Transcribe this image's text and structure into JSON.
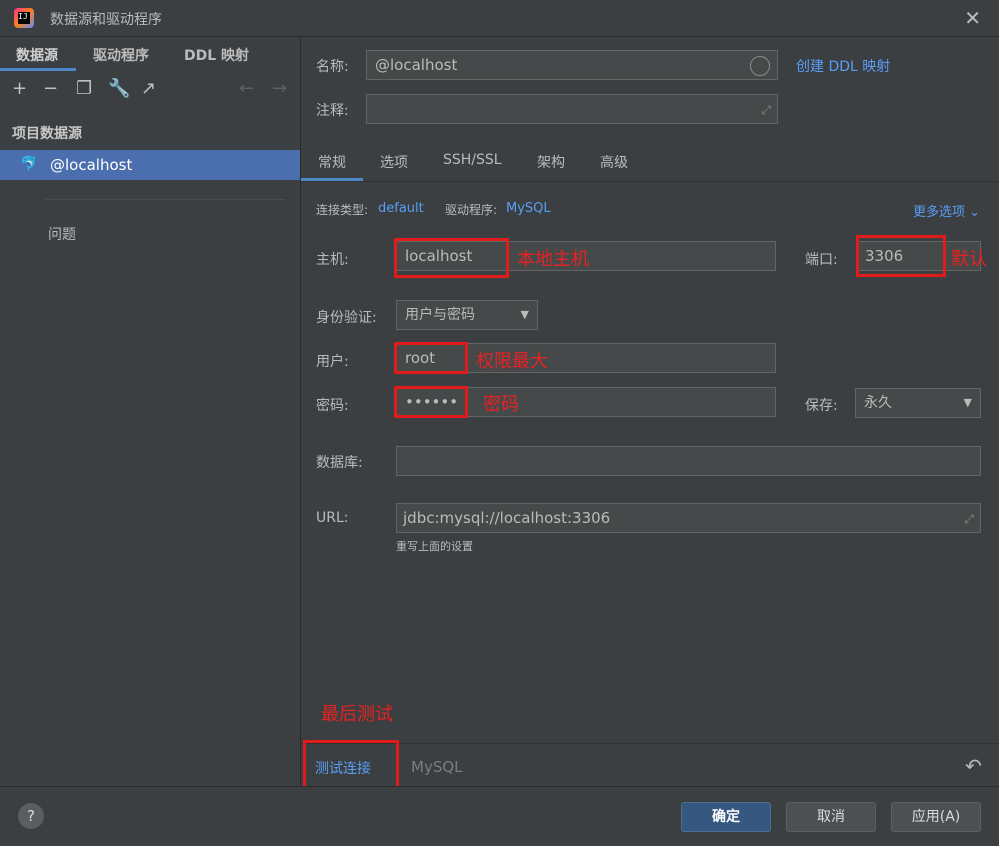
{
  "window": {
    "title": "数据源和驱动程序",
    "close_label": "✕"
  },
  "left": {
    "tabs": [
      "数据源",
      "驱动程序",
      "DDL 映射"
    ],
    "toolbar_icons": [
      "add-icon",
      "remove-icon",
      "copy-icon",
      "wrench-icon",
      "jump-icon",
      "back-arrow-icon",
      "forward-arrow-icon"
    ],
    "section_title": "项目数据源",
    "datasource": "@localhost",
    "problems": "问题"
  },
  "form": {
    "name_label": "名称:",
    "name_value": "@localhost",
    "create_ddl_link": "创建 DDL 映射",
    "comment_label": "注释:",
    "comment_value": "",
    "tabs": [
      "常规",
      "选项",
      "SSH/SSL",
      "架构",
      "高级"
    ],
    "conn_type_label": "连接类型:",
    "conn_type_value": "default",
    "driver_label": "驱动程序:",
    "driver_value": "MySQL",
    "more_options": "更多选项",
    "host_label": "主机:",
    "host_value": "localhost",
    "port_label": "端口:",
    "port_value": "3306",
    "auth_label": "身份验证:",
    "auth_value": "用户与密码",
    "user_label": "用户:",
    "user_value": "root",
    "password_label": "密码:",
    "password_value": "••••••",
    "save_label": "保存:",
    "save_value": "永久",
    "database_label": "数据库:",
    "database_value": "",
    "url_label": "URL:",
    "url_value": "jdbc:mysql://localhost:3306",
    "url_hint": "重写上面的设置"
  },
  "annotations": {
    "host": "本地主机",
    "port": "默认",
    "user": "权限最大",
    "password": "密码",
    "test": "最后测试"
  },
  "bottom": {
    "test_connection": "测试连接",
    "driver_name": "MySQL",
    "revert_icon": "↶"
  },
  "footer": {
    "help": "?",
    "ok": "确定",
    "cancel": "取消",
    "apply": "应用(A)"
  }
}
